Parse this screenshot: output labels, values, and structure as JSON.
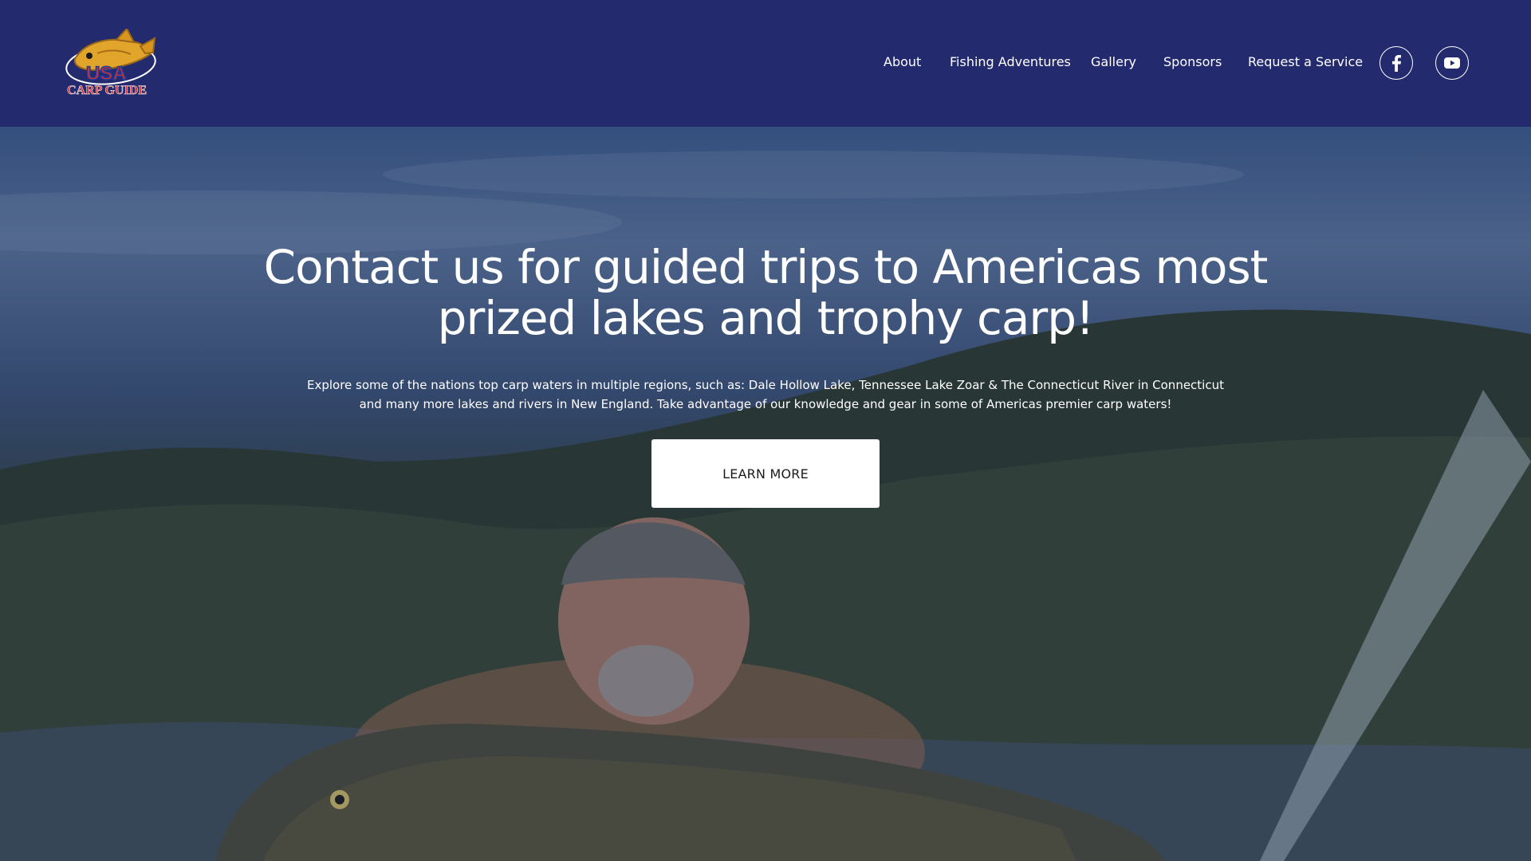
{
  "brand": {
    "logo_top": "USA",
    "logo_bottom": "CARP GUIDE"
  },
  "nav": {
    "items": [
      {
        "label": "About"
      },
      {
        "label": "Fishing Adventures"
      },
      {
        "label": "Gallery"
      },
      {
        "label": "Sponsors"
      },
      {
        "label": "Request a Service"
      }
    ],
    "social": [
      {
        "icon": "facebook-icon"
      },
      {
        "icon": "youtube-icon"
      }
    ]
  },
  "hero": {
    "headline": "Contact us for guided trips to Americas most prized lakes and trophy carp!",
    "subtext": "Explore some of the nations top carp waters in multiple regions, such as: Dale Hollow Lake, Tennessee Lake Zoar & The Connecticut River in Connecticut and many more lakes and rivers in New England. Take advantage of our knowledge and gear in some of Americas premier carp waters!",
    "cta_label": "LEARN MORE"
  },
  "colors": {
    "header_bg": "#232a6e",
    "text": "#ffffff",
    "logo_red": "#d62f2f",
    "logo_blue": "#1f3a9b",
    "logo_gold": "#e2a52b"
  }
}
